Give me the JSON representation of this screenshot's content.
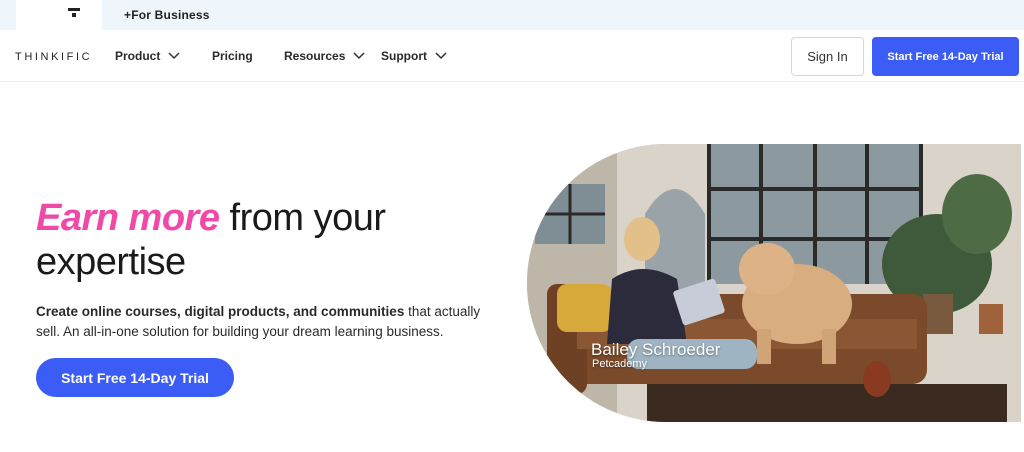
{
  "topbar": {
    "business_label": "+For Business"
  },
  "nav": {
    "logo": "THINKIFIC",
    "items": [
      {
        "label": "Product",
        "has_dropdown": true
      },
      {
        "label": "Pricing",
        "has_dropdown": false
      },
      {
        "label": "Resources",
        "has_dropdown": true
      },
      {
        "label": "Support",
        "has_dropdown": true
      }
    ],
    "sign_in": "Sign In",
    "trial": "Start Free 14-Day Trial"
  },
  "hero": {
    "headline_accent": "Earn more",
    "headline_rest": "from your",
    "headline_line2": "expertise",
    "sub_bold": "Create online courses, digital products, and communities",
    "sub_rest": "that actually sell. An all-in-one solution for building your dream learning business.",
    "cta": "Start Free 14-Day Trial",
    "photo_caption_name": "Bailey Schroeder",
    "photo_caption_org": "Petcademy"
  },
  "colors": {
    "accent_blue": "#3b5cf5",
    "accent_pink": "#f04aa8",
    "topbar_bg": "#eef6fb"
  },
  "icons": [
    "thinkific-mark-icon",
    "chevron-down-icon"
  ]
}
